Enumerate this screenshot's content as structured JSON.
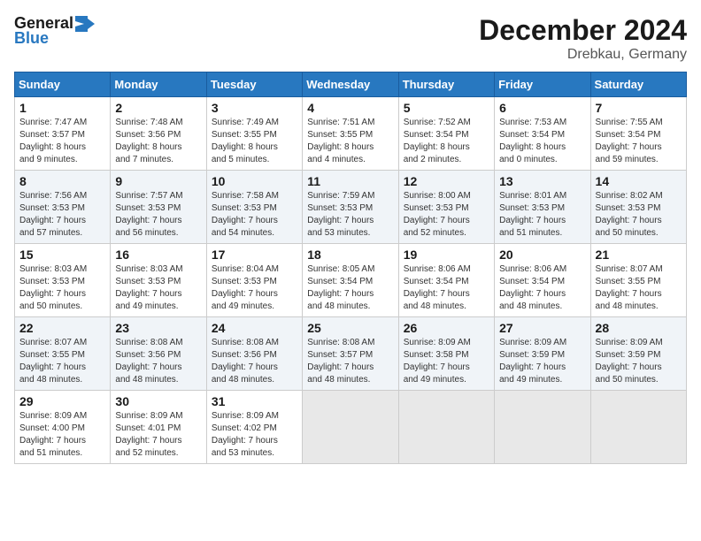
{
  "header": {
    "logo_line1": "General",
    "logo_line2": "Blue",
    "month_title": "December 2024",
    "location": "Drebkau, Germany"
  },
  "days_of_week": [
    "Sunday",
    "Monday",
    "Tuesday",
    "Wednesday",
    "Thursday",
    "Friday",
    "Saturday"
  ],
  "weeks": [
    [
      {
        "day": "1",
        "info": "Sunrise: 7:47 AM\nSunset: 3:57 PM\nDaylight: 8 hours\nand 9 minutes."
      },
      {
        "day": "2",
        "info": "Sunrise: 7:48 AM\nSunset: 3:56 PM\nDaylight: 8 hours\nand 7 minutes."
      },
      {
        "day": "3",
        "info": "Sunrise: 7:49 AM\nSunset: 3:55 PM\nDaylight: 8 hours\nand 5 minutes."
      },
      {
        "day": "4",
        "info": "Sunrise: 7:51 AM\nSunset: 3:55 PM\nDaylight: 8 hours\nand 4 minutes."
      },
      {
        "day": "5",
        "info": "Sunrise: 7:52 AM\nSunset: 3:54 PM\nDaylight: 8 hours\nand 2 minutes."
      },
      {
        "day": "6",
        "info": "Sunrise: 7:53 AM\nSunset: 3:54 PM\nDaylight: 8 hours\nand 0 minutes."
      },
      {
        "day": "7",
        "info": "Sunrise: 7:55 AM\nSunset: 3:54 PM\nDaylight: 7 hours\nand 59 minutes."
      }
    ],
    [
      {
        "day": "8",
        "info": "Sunrise: 7:56 AM\nSunset: 3:53 PM\nDaylight: 7 hours\nand 57 minutes."
      },
      {
        "day": "9",
        "info": "Sunrise: 7:57 AM\nSunset: 3:53 PM\nDaylight: 7 hours\nand 56 minutes."
      },
      {
        "day": "10",
        "info": "Sunrise: 7:58 AM\nSunset: 3:53 PM\nDaylight: 7 hours\nand 54 minutes."
      },
      {
        "day": "11",
        "info": "Sunrise: 7:59 AM\nSunset: 3:53 PM\nDaylight: 7 hours\nand 53 minutes."
      },
      {
        "day": "12",
        "info": "Sunrise: 8:00 AM\nSunset: 3:53 PM\nDaylight: 7 hours\nand 52 minutes."
      },
      {
        "day": "13",
        "info": "Sunrise: 8:01 AM\nSunset: 3:53 PM\nDaylight: 7 hours\nand 51 minutes."
      },
      {
        "day": "14",
        "info": "Sunrise: 8:02 AM\nSunset: 3:53 PM\nDaylight: 7 hours\nand 50 minutes."
      }
    ],
    [
      {
        "day": "15",
        "info": "Sunrise: 8:03 AM\nSunset: 3:53 PM\nDaylight: 7 hours\nand 50 minutes."
      },
      {
        "day": "16",
        "info": "Sunrise: 8:03 AM\nSunset: 3:53 PM\nDaylight: 7 hours\nand 49 minutes."
      },
      {
        "day": "17",
        "info": "Sunrise: 8:04 AM\nSunset: 3:53 PM\nDaylight: 7 hours\nand 49 minutes."
      },
      {
        "day": "18",
        "info": "Sunrise: 8:05 AM\nSunset: 3:54 PM\nDaylight: 7 hours\nand 48 minutes."
      },
      {
        "day": "19",
        "info": "Sunrise: 8:06 AM\nSunset: 3:54 PM\nDaylight: 7 hours\nand 48 minutes."
      },
      {
        "day": "20",
        "info": "Sunrise: 8:06 AM\nSunset: 3:54 PM\nDaylight: 7 hours\nand 48 minutes."
      },
      {
        "day": "21",
        "info": "Sunrise: 8:07 AM\nSunset: 3:55 PM\nDaylight: 7 hours\nand 48 minutes."
      }
    ],
    [
      {
        "day": "22",
        "info": "Sunrise: 8:07 AM\nSunset: 3:55 PM\nDaylight: 7 hours\nand 48 minutes."
      },
      {
        "day": "23",
        "info": "Sunrise: 8:08 AM\nSunset: 3:56 PM\nDaylight: 7 hours\nand 48 minutes."
      },
      {
        "day": "24",
        "info": "Sunrise: 8:08 AM\nSunset: 3:56 PM\nDaylight: 7 hours\nand 48 minutes."
      },
      {
        "day": "25",
        "info": "Sunrise: 8:08 AM\nSunset: 3:57 PM\nDaylight: 7 hours\nand 48 minutes."
      },
      {
        "day": "26",
        "info": "Sunrise: 8:09 AM\nSunset: 3:58 PM\nDaylight: 7 hours\nand 49 minutes."
      },
      {
        "day": "27",
        "info": "Sunrise: 8:09 AM\nSunset: 3:59 PM\nDaylight: 7 hours\nand 49 minutes."
      },
      {
        "day": "28",
        "info": "Sunrise: 8:09 AM\nSunset: 3:59 PM\nDaylight: 7 hours\nand 50 minutes."
      }
    ],
    [
      {
        "day": "29",
        "info": "Sunrise: 8:09 AM\nSunset: 4:00 PM\nDaylight: 7 hours\nand 51 minutes."
      },
      {
        "day": "30",
        "info": "Sunrise: 8:09 AM\nSunset: 4:01 PM\nDaylight: 7 hours\nand 52 minutes."
      },
      {
        "day": "31",
        "info": "Sunrise: 8:09 AM\nSunset: 4:02 PM\nDaylight: 7 hours\nand 53 minutes."
      },
      {
        "day": "",
        "info": ""
      },
      {
        "day": "",
        "info": ""
      },
      {
        "day": "",
        "info": ""
      },
      {
        "day": "",
        "info": ""
      }
    ]
  ]
}
